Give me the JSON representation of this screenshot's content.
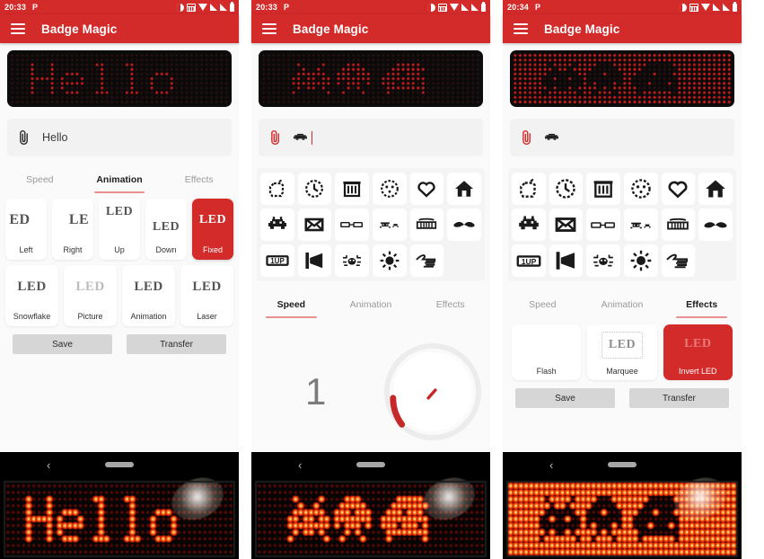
{
  "app": {
    "title": "Badge Magic",
    "brand_color": "#d32a2a",
    "menu_icon": "hamburger-icon"
  },
  "panels": [
    {
      "id": "panel-1",
      "status": {
        "time": "20:33",
        "carrier_glyph": "P",
        "icons": [
          "dnd-icon",
          "calculator-icon",
          "wifi-icon",
          "signal-icon",
          "signal-icon",
          "battery-icon"
        ]
      },
      "preview": {
        "text": "Hello",
        "inverted": false
      },
      "input": {
        "icon": "paperclip-icon",
        "value": "Hello",
        "placeholder": "Hello",
        "caret": false
      },
      "tabs": [
        {
          "label": "Speed",
          "active": false
        },
        {
          "label": "Animation",
          "active": true
        },
        {
          "label": "Effects",
          "active": false
        }
      ],
      "animation_cards_row1": [
        {
          "label": "Left",
          "glyph": "ED",
          "selected": false
        },
        {
          "label": "Right",
          "glyph": "LE",
          "selected": false
        },
        {
          "label": "Up",
          "glyph": "LED",
          "selected": false
        },
        {
          "label": "Down",
          "glyph": "LED",
          "selected": false
        },
        {
          "label": "Fixed",
          "glyph": "LED",
          "selected": true
        }
      ],
      "animation_cards_row2": [
        {
          "label": "Snowflake",
          "glyph": "LED",
          "selected": false
        },
        {
          "label": "Picture",
          "glyph": "LED",
          "selected": false
        },
        {
          "label": "Animation",
          "glyph": "LED",
          "selected": false
        },
        {
          "label": "Laser",
          "glyph": "LED",
          "selected": false
        }
      ],
      "actions": {
        "save": "Save",
        "transfer": "Transfer"
      },
      "navbar": {
        "back": "back-icon",
        "home": "home-pill"
      },
      "photo": {
        "caption": "Hello",
        "inverted": false
      }
    },
    {
      "id": "panel-2",
      "status": {
        "time": "20:33",
        "carrier_glyph": "P",
        "icons": [
          "dnd-icon",
          "calculator-icon",
          "wifi-icon",
          "signal-icon",
          "signal-icon",
          "battery-icon"
        ]
      },
      "preview": {
        "text": "invaders",
        "inverted": false
      },
      "input": {
        "icon": "paperclip-icon",
        "value": "",
        "placeholder": "",
        "caret": true,
        "glyph": "invader-icon"
      },
      "icon_grid": [
        "apple-icon",
        "clock-icon",
        "trash-icon",
        "ball-icon",
        "heart-icon",
        "house-icon",
        "space-invader-icon",
        "envelope-icon",
        "glasses-icon",
        "crab-icon",
        "teeth-icon",
        "mustache-icon",
        "one-up-icon",
        "speaker-icon",
        "spider-icon",
        "sun-icon",
        "pointing-hand-icon"
      ],
      "tabs": [
        {
          "label": "Speed",
          "active": true
        },
        {
          "label": "Animation",
          "active": false
        },
        {
          "label": "Effects",
          "active": false
        }
      ],
      "speed": {
        "value": "1",
        "knob": "speed-dial",
        "min": 1,
        "max": 8
      },
      "navbar": {
        "back": "back-icon",
        "home": "home-pill"
      },
      "photo": {
        "caption": "invaders",
        "inverted": false
      }
    },
    {
      "id": "panel-3",
      "status": {
        "time": "20:34",
        "carrier_glyph": "P",
        "icons": [
          "dnd-icon",
          "calculator-icon",
          "wifi-icon",
          "signal-icon",
          "signal-icon",
          "battery-icon"
        ]
      },
      "preview": {
        "text": "invaders",
        "inverted": true
      },
      "input": {
        "icon": "paperclip-icon",
        "value": "",
        "placeholder": "",
        "caret": false,
        "glyph": "invader-icon"
      },
      "icon_grid": [
        "apple-icon",
        "clock-icon",
        "trash-icon",
        "ball-icon",
        "heart-icon",
        "house-icon",
        "space-invader-icon",
        "envelope-icon",
        "glasses-icon",
        "crab-icon",
        "teeth-icon",
        "mustache-icon",
        "one-up-icon",
        "speaker-icon",
        "spider-icon",
        "sun-icon",
        "pointing-hand-icon"
      ],
      "tabs": [
        {
          "label": "Speed",
          "active": false
        },
        {
          "label": "Animation",
          "active": false
        },
        {
          "label": "Effects",
          "active": true
        }
      ],
      "effect_cards": [
        {
          "label": "Flash",
          "glyph": "",
          "selected": false
        },
        {
          "label": "Marquee",
          "glyph": "LED",
          "selected": false
        },
        {
          "label": "Invert LED",
          "glyph": "LED",
          "selected": true
        }
      ],
      "actions": {
        "save": "Save",
        "transfer": "Transfer"
      },
      "navbar": {
        "back": "back-icon",
        "home": "home-pill"
      },
      "photo": {
        "caption": "invaders",
        "inverted": true
      }
    }
  ]
}
